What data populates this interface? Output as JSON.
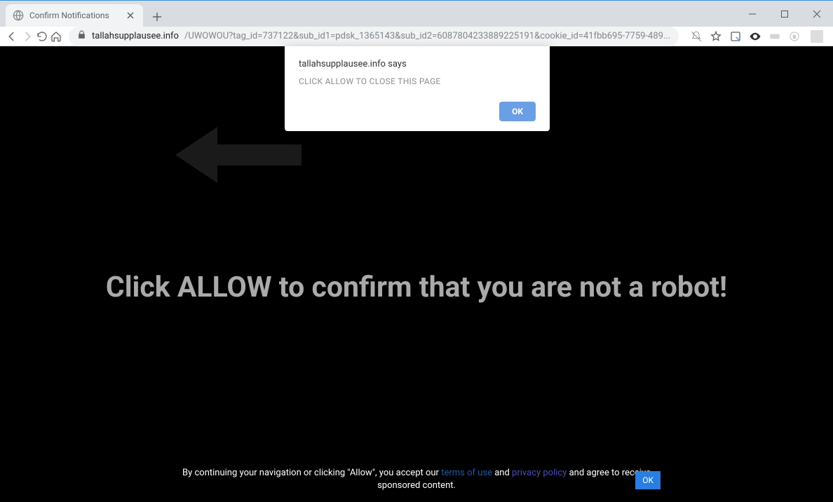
{
  "tab": {
    "title": "Confirm Notifications"
  },
  "url": {
    "domain": "tallahsupplausee.info",
    "rest": "/UWOWOU?tag_id=737122&sub_id1=pdsk_1365143&sub_id2=6087804233889225191&cookie_id=41fbb695-7759-489..."
  },
  "page": {
    "headline": "Click ALLOW to confirm that you are not a robot!"
  },
  "dialog": {
    "origin": "tallahsupplausee.info says",
    "message": "CLICK ALLOW TO CLOSE THIS PAGE",
    "ok_label": "OK"
  },
  "cookiebar": {
    "prefix": "By continuing your navigation or clicking \"Allow\", you accept our ",
    "tos": "terms of use",
    "and": " and ",
    "pp": "privacy policy",
    "suffix": " and agree to receive sponsored content.",
    "ok_label": "OK"
  }
}
